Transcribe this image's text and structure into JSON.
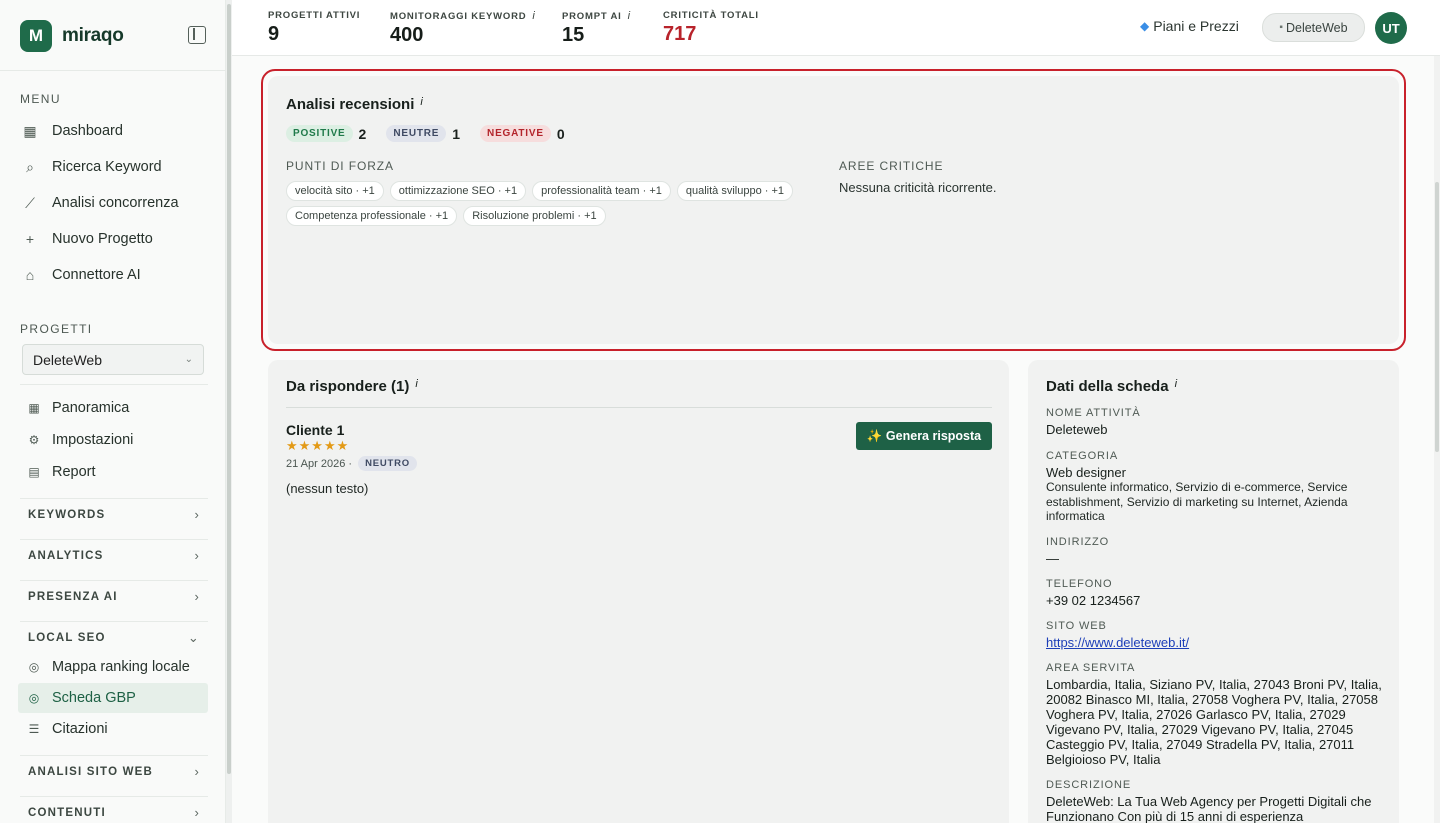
{
  "brand": {
    "name": "miraqo",
    "logo_letter": "M"
  },
  "sidebar": {
    "menu_title": "MENU",
    "menu": [
      {
        "label": "Dashboard",
        "icon": "dashboard-icon"
      },
      {
        "label": "Ricerca Keyword",
        "icon": "search-icon"
      },
      {
        "label": "Analisi concorrenza",
        "icon": "chart-line-icon"
      },
      {
        "label": "Nuovo Progetto",
        "icon": "plus-icon"
      },
      {
        "label": "Connettore AI",
        "icon": "robot-icon"
      }
    ],
    "projects_title": "PROGETTI",
    "project_select": "DeleteWeb",
    "project_items": [
      {
        "label": "Panoramica",
        "icon": "grid-icon"
      },
      {
        "label": "Impostazioni",
        "icon": "gear-icon"
      },
      {
        "label": "Report",
        "icon": "document-icon"
      }
    ],
    "groups": {
      "keywords": "KEYWORDS",
      "analytics": "ANALYTICS",
      "presenza_ai": "PRESENZA AI",
      "local_seo": "LOCAL SEO",
      "analisi_sito": "ANALISI SITO WEB",
      "contenuti": "CONTENUTI"
    },
    "local_seo_items": [
      {
        "label": "Mappa ranking locale",
        "icon": "map-pin-icon"
      },
      {
        "label": "Scheda GBP",
        "icon": "map-pin-icon"
      },
      {
        "label": "Citazioni",
        "icon": "list-icon"
      }
    ]
  },
  "topbar": {
    "stats": [
      {
        "label": "PROGETTI ATTIVI",
        "value": "9",
        "info": ""
      },
      {
        "label": "MONITORAGGI KEYWORD",
        "value": "400",
        "info": "i"
      },
      {
        "label": "PROMPT AI",
        "value": "15",
        "info": "i"
      },
      {
        "label": "CRITICITÀ TOTALI",
        "value": "717",
        "info": ""
      }
    ],
    "plans_label": "Piani e Prezzi",
    "workspace_label": "DeleteWeb",
    "avatar_initials": "UT",
    "critical_color": "#b8232b"
  },
  "reviews": {
    "title": "Analisi recensioni",
    "info": "i",
    "positive_label": "POSITIVE",
    "positive_count": "2",
    "neutral_label": "NEUTRE",
    "neutral_count": "1",
    "negative_label": "NEGATIVE",
    "negative_count": "0",
    "strengths_title": "PUNTI DI FORZA",
    "strengths": [
      "velocità sito · +1",
      "ottimizzazione SEO · +1",
      "professionalità team · +1",
      "qualità sviluppo · +1",
      "Competenza professionale · +1",
      "Risoluzione problemi · +1"
    ],
    "critical_title": "AREE CRITICHE",
    "critical_text": "Nessuna criticità ricorrente.",
    "highlight_color": "#c8212b"
  },
  "to_answer": {
    "title": "Da rispondere (1)",
    "info": "i",
    "review": {
      "author": "Cliente 1",
      "stars": "★★★★★",
      "date": "21 Apr 2026 ·",
      "badge": "NEUTRO",
      "text": "(nessun testo)",
      "button": "✨ Genera risposta"
    }
  },
  "listing": {
    "title": "Dati della scheda",
    "info": "i",
    "name_label": "NOME ATTIVITÀ",
    "name_value": "Deleteweb",
    "category_label": "CATEGORIA",
    "category_main": "Web designer",
    "category_extra": "Consulente informatico, Servizio di e-commerce, Service establishment, Servizio di marketing su Internet, Azienda informatica",
    "address_label": "INDIRIZZO",
    "address_value": "—",
    "phone_label": "TELEFONO",
    "phone_value": "+39 02 1234567",
    "website_label": "SITO WEB",
    "website_value": "https://www.deleteweb.it/",
    "area_label": "AREA SERVITA",
    "area_value": "Lombardia, Italia, Siziano PV, Italia, 27043 Broni PV, Italia, 20082 Binasco MI, Italia, 27058 Voghera PV, Italia, 27058 Voghera PV, Italia, 27026 Garlasco PV, Italia, 27029 Vigevano PV, Italia, 27029 Vigevano PV, Italia, 27045 Casteggio PV, Italia, 27049 Stradella PV, Italia, 27011 Belgioioso PV, Italia",
    "description_label": "DESCRIZIONE",
    "description_value": "DeleteWeb: La Tua Web Agency per Progetti Digitali che Funzionano Con più di 15 anni di esperienza"
  }
}
